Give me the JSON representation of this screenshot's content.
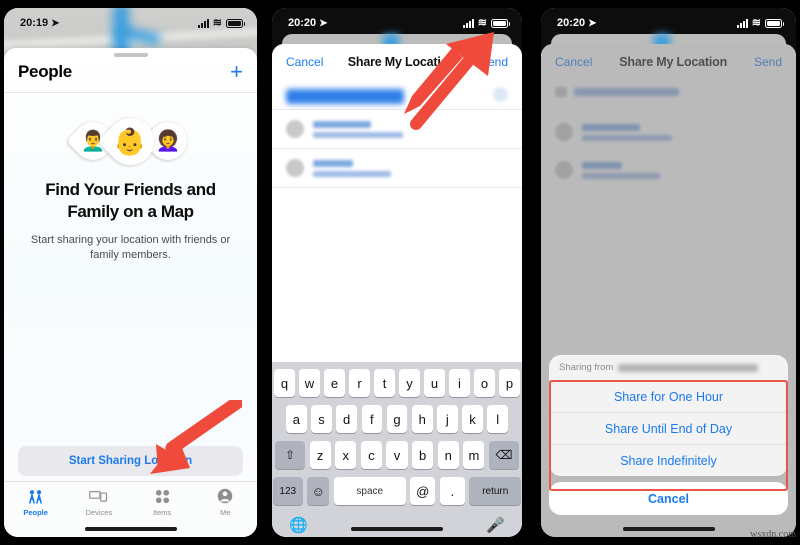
{
  "watermark": "wsxdn.com",
  "panel1": {
    "status": {
      "time": "20:19",
      "location_icon": "location-arrow-icon",
      "wifi_icon": "wifi-icon",
      "battery_icon": "battery-icon"
    },
    "sheet_title": "People",
    "add_button": "+",
    "hero_title": "Find Your Friends and Family on a Map",
    "hero_subtitle": "Start sharing your location with friends or family members.",
    "start_button": "Start Sharing Location",
    "avatars": [
      {
        "name": "memoji-left",
        "glyph": "👨‍🦱"
      },
      {
        "name": "memoji-center",
        "glyph": "👶"
      },
      {
        "name": "memoji-right",
        "glyph": "👩‍🦱"
      }
    ],
    "tabs": [
      {
        "label": "People",
        "icon": "people-icon",
        "active": true
      },
      {
        "label": "Devices",
        "icon": "devices-icon",
        "active": false
      },
      {
        "label": "Items",
        "icon": "items-icon",
        "active": false
      },
      {
        "label": "Me",
        "icon": "person-circle-icon",
        "active": false
      }
    ]
  },
  "panel2": {
    "status": {
      "time": "20:20"
    },
    "cancel": "Cancel",
    "title": "Share My Location",
    "send": "Send",
    "keyboard": {
      "row1": [
        "q",
        "w",
        "e",
        "r",
        "t",
        "y",
        "u",
        "i",
        "o",
        "p"
      ],
      "row2": [
        "a",
        "s",
        "d",
        "f",
        "g",
        "h",
        "j",
        "k",
        "l"
      ],
      "row3": [
        "z",
        "x",
        "c",
        "v",
        "b",
        "n",
        "m"
      ],
      "shift": "⇧",
      "backspace": "⌫",
      "numbers": "123",
      "emoji": "☺",
      "space": "space",
      "at": "@",
      "period": ".",
      "return": "return",
      "globe": "⊕",
      "mic": "Ω"
    }
  },
  "panel3": {
    "status": {
      "time": "20:20"
    },
    "cancel": "Cancel",
    "title": "Share My Location",
    "send": "Send",
    "action_sheet": {
      "header_label": "Sharing from",
      "options": [
        "Share for One Hour",
        "Share Until End of Day",
        "Share Indefinitely"
      ],
      "cancel": "Cancel"
    }
  },
  "colors": {
    "accent_blue": "#1a7af0",
    "annotation_red": "#e8554a",
    "keyboard_bg": "#d1d3d9"
  }
}
